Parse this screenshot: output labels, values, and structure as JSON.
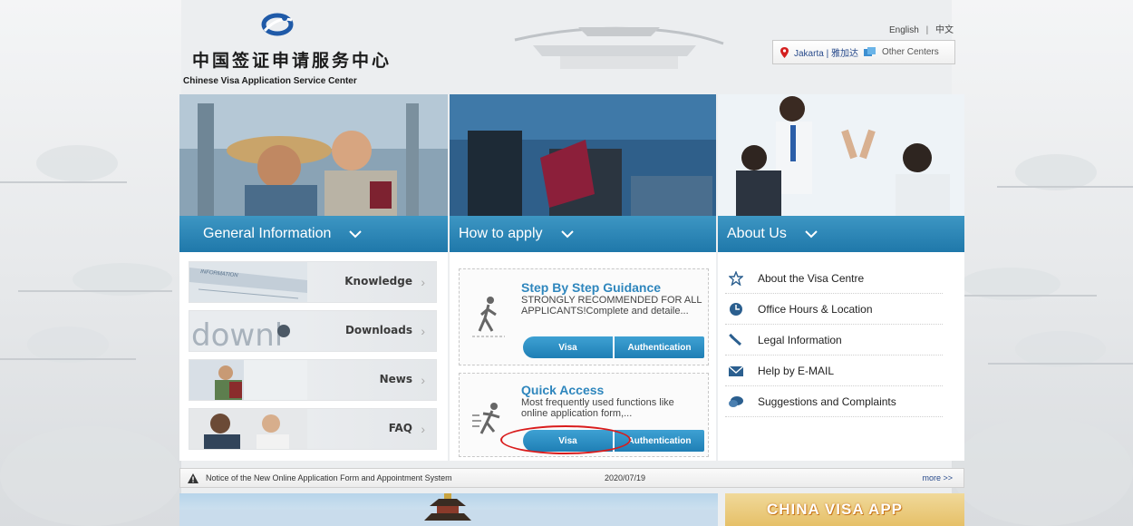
{
  "header": {
    "logo_cn": "中国签证申请服务中心",
    "logo_en": "Chinese Visa Application Service Center",
    "lang_english": "English",
    "lang_separator": "|",
    "lang_chinese": "中文",
    "center_current": "Jakarta | 雅加达",
    "center_other": "Other Centers"
  },
  "columns": {
    "general": {
      "label": "General Information",
      "items": [
        {
          "label": "Knowledge",
          "thumb_text": "INFORMATION"
        },
        {
          "label": "Downloads",
          "thumb_text": "downl"
        },
        {
          "label": "News"
        },
        {
          "label": "FAQ"
        }
      ]
    },
    "apply": {
      "label": "How to apply",
      "cards": [
        {
          "title": "Step By Step Guidance",
          "desc": "STRONGLY RECOMMENDED FOR ALL APPLICANTS!Complete and detaile...",
          "btn_visa": "Visa",
          "btn_auth": "Authentication"
        },
        {
          "title": "Quick Access",
          "desc": "Most frequently used functions like online application form,...",
          "btn_visa": "Visa",
          "btn_auth": "Authentication"
        }
      ]
    },
    "about": {
      "label": "About Us",
      "items": [
        {
          "label": "About the Visa Centre",
          "icon": "star-icon"
        },
        {
          "label": "Office Hours & Location",
          "icon": "clock-icon"
        },
        {
          "label": "Legal Information",
          "icon": "gavel-icon"
        },
        {
          "label": "Help by E-MAIL",
          "icon": "mail-icon"
        },
        {
          "label": "Suggestions and Complaints",
          "icon": "chat-icon"
        }
      ]
    }
  },
  "notice": {
    "text": "Notice of the New Online Application Form and Appointment System",
    "date": "2020/07/19",
    "more": "more >>"
  },
  "banners": {
    "app_text": "CHINA VISA APP"
  },
  "colors": {
    "accent_blue": "#2b8ac1",
    "highlight_red": "#d91c1c",
    "link_blue": "#2a4c8c"
  }
}
